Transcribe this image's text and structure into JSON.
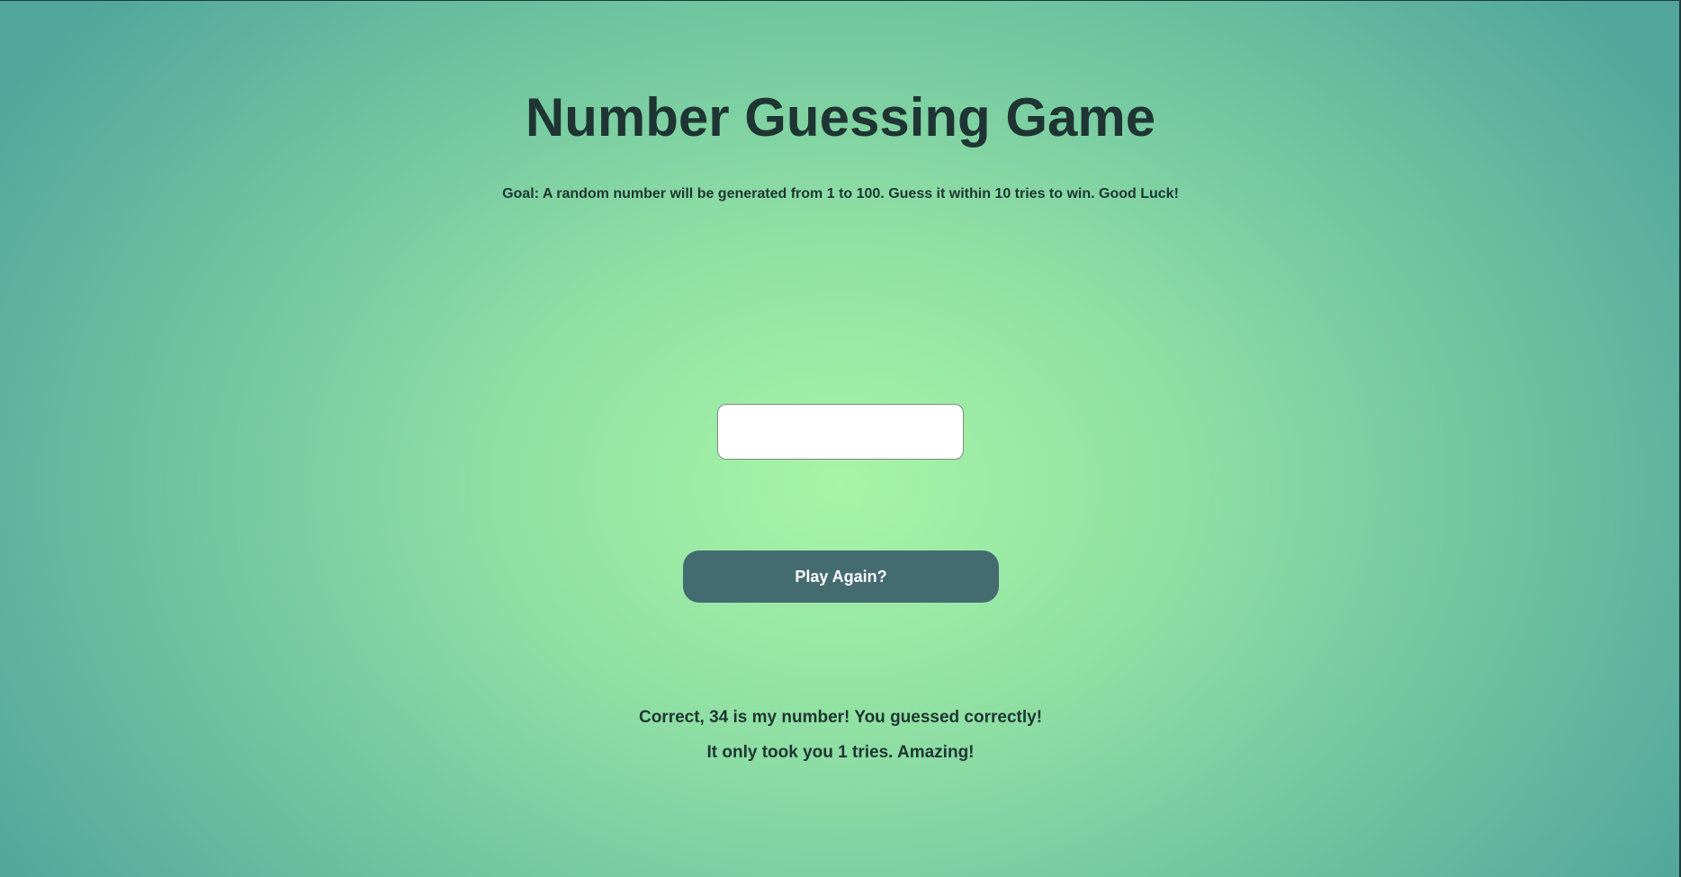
{
  "game": {
    "title": "Number Guessing Game",
    "goal": "Goal: A random number will be generated from 1 to 100. Guess it within 10 tries to win. Good Luck!",
    "guess_input": {
      "value": "",
      "placeholder": ""
    },
    "play_again_label": "Play Again?",
    "result_message": "Correct, 34 is my number! You guessed correctly!",
    "tries_message": "It only took you 1 tries. Amazing!"
  },
  "colors": {
    "button_background": "#446b70",
    "text": "#1e3533",
    "background_center": "#a8f5a6",
    "background_edge": "#52a69b"
  }
}
